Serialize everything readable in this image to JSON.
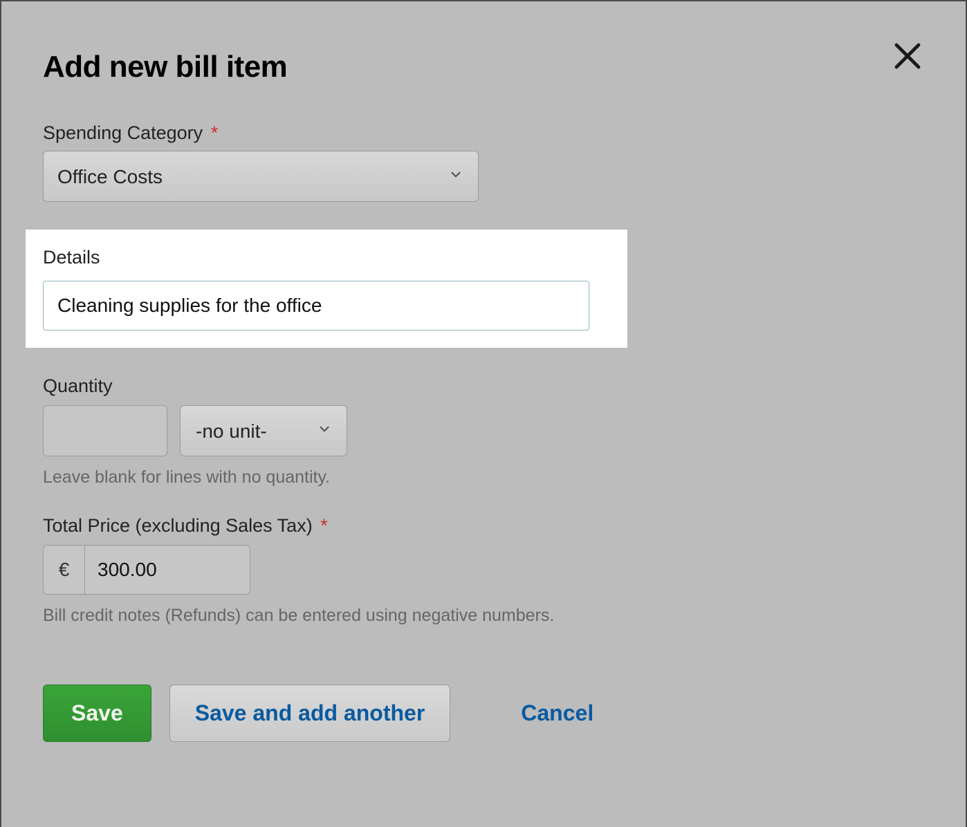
{
  "modal": {
    "title": "Add new bill item",
    "spending_category": {
      "label": "Spending Category",
      "required_marker": "*",
      "value": "Office Costs"
    },
    "details": {
      "label": "Details",
      "value": "Cleaning supplies for the office"
    },
    "quantity": {
      "label": "Quantity",
      "value": "",
      "unit_value": "-no unit-",
      "hint": "Leave blank for lines with no quantity."
    },
    "total_price": {
      "label": "Total Price (excluding Sales Tax)",
      "required_marker": "*",
      "currency_symbol": "€",
      "value": "300.00",
      "hint": "Bill credit notes (Refunds) can be entered using negative numbers."
    },
    "actions": {
      "save": "Save",
      "save_and_add": "Save and add another",
      "cancel": "Cancel"
    }
  }
}
